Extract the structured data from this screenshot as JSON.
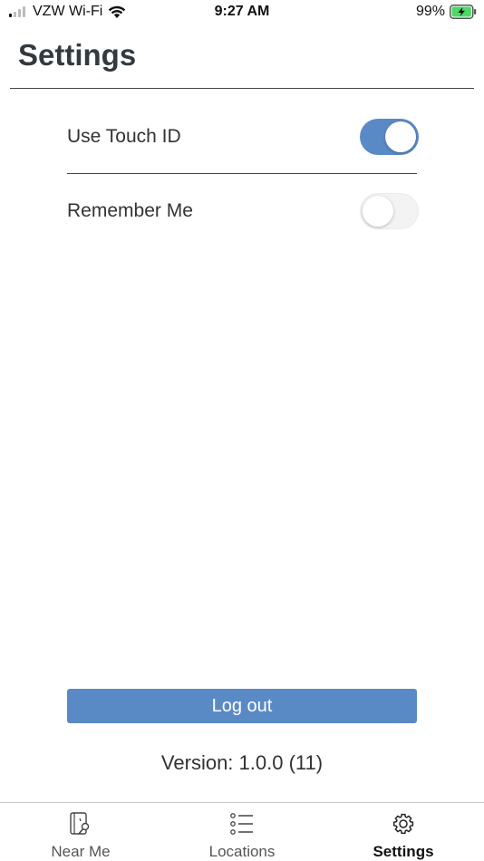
{
  "status_bar": {
    "carrier": "VZW Wi-Fi",
    "time": "9:27 AM",
    "battery_percent": "99%",
    "battery_level": 0.99,
    "signal_bars": 1,
    "icons": [
      "signal-icon",
      "wifi-icon",
      "battery-charging-icon"
    ]
  },
  "header": {
    "title": "Settings"
  },
  "settings": {
    "items": [
      {
        "label": "Use Touch ID",
        "enabled": true
      },
      {
        "label": "Remember Me",
        "enabled": false
      }
    ]
  },
  "actions": {
    "logout_label": "Log out"
  },
  "footer": {
    "version": "Version: 1.0.0 (11)"
  },
  "tab_bar": {
    "tabs": [
      {
        "label": "Near Me",
        "icon": "near-me-icon",
        "active": false
      },
      {
        "label": "Locations",
        "icon": "list-icon",
        "active": false
      },
      {
        "label": "Settings",
        "icon": "gear-icon",
        "active": true
      }
    ]
  },
  "colors": {
    "accent": "#5a8ac6",
    "title": "#333a3f",
    "toggle_off": "#f3f3f3"
  }
}
